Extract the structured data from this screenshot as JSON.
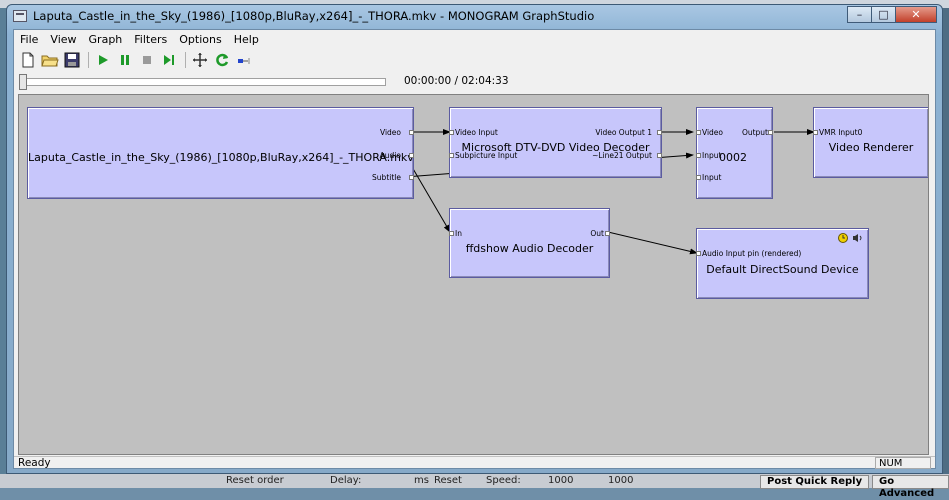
{
  "window": {
    "title": "Laputa_Castle_in_the_Sky_(1986)_[1080p,BluRay,x264]_-_THORA.mkv - MONOGRAM GraphStudio",
    "buttons": {
      "minimize": "–",
      "maximize": "□",
      "close": "✕"
    }
  },
  "menu": [
    "File",
    "View",
    "Graph",
    "Filters",
    "Options",
    "Help"
  ],
  "toolbar": {
    "icons": [
      "new-icon",
      "open-icon",
      "save-icon",
      "play-icon",
      "pause-icon",
      "stop-icon",
      "step-icon",
      "arrange-icon",
      "refresh-icon",
      "toggle-icon"
    ]
  },
  "position": {
    "time": "00:00:00 / 02:04:33",
    "progress": 0
  },
  "graph": {
    "filters": {
      "source": {
        "name": "Laputa_Castle_in_the_Sky_(1986)_[1080p,BluRay,x264]_-_THORA.mkv",
        "pins": {
          "video": "Video",
          "audio": "Audio",
          "subtitle": "Subtitle"
        }
      },
      "dvd": {
        "name": "Microsoft DTV-DVD Video Decoder",
        "pins": {
          "video_input": "Video Input",
          "subpicture_input": "Subpicture Input",
          "video_output": "Video Output 1",
          "line21": "~Line21 Output"
        }
      },
      "mixer": {
        "name": "0002",
        "pins": {
          "video": "Video",
          "input1": "Input",
          "input2": "Input",
          "output": "Output"
        }
      },
      "renderer": {
        "name": "Video Renderer",
        "pins": {
          "vmr_input": "VMR Input0"
        }
      },
      "ffdshow": {
        "name": "ffdshow Audio Decoder",
        "pins": {
          "in": "In",
          "out": "Out"
        }
      },
      "dsound": {
        "name": "Default DirectSound Device",
        "pins": {
          "audio_input": "Audio Input pin (rendered)"
        }
      }
    }
  },
  "status": {
    "text": "Ready",
    "num": "NUM"
  },
  "background": {
    "reset_order": "Reset order",
    "delay": "Delay:",
    "ms": "ms",
    "reset": "Reset",
    "speed": "Speed:",
    "val1": "1000",
    "val2": "1000",
    "post_quick_reply": "Post Quick Reply",
    "go_advanced": "Go Advanced"
  }
}
